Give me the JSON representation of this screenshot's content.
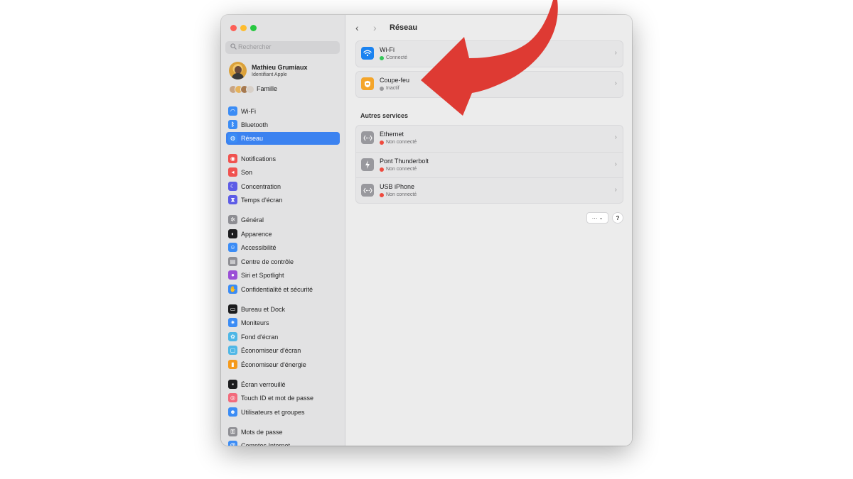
{
  "search": {
    "placeholder": "Rechercher"
  },
  "account": {
    "name": "Mathieu Grumiaux",
    "subtitle": "Identifiant Apple"
  },
  "family": {
    "label": "Famille"
  },
  "sidebar": {
    "items": [
      {
        "label": "Wi-Fi",
        "icon": "wifi-icon",
        "color": "#3b8cf5"
      },
      {
        "label": "Bluetooth",
        "icon": "bluetooth-icon",
        "color": "#3b8cf5"
      },
      {
        "label": "Réseau",
        "icon": "globe-icon",
        "color": "#3b8cf5",
        "selected": true
      },
      {
        "label": "Notifications",
        "icon": "bell-icon",
        "color": "#f0524f"
      },
      {
        "label": "Son",
        "icon": "speaker-icon",
        "color": "#f0524f"
      },
      {
        "label": "Concentration",
        "icon": "moon-icon",
        "color": "#5d5ce6"
      },
      {
        "label": "Temps d'écran",
        "icon": "hourglass-icon",
        "color": "#5d5ce6"
      },
      {
        "label": "Général",
        "icon": "gear-icon",
        "color": "#8e8e93"
      },
      {
        "label": "Apparence",
        "icon": "appearance-icon",
        "color": "#1c1c1e"
      },
      {
        "label": "Accessibilité",
        "icon": "accessibility-icon",
        "color": "#3b8cf5"
      },
      {
        "label": "Centre de contrôle",
        "icon": "control-center-icon",
        "color": "#8e8e93"
      },
      {
        "label": "Siri et Spotlight",
        "icon": "siri-icon",
        "color": "#9b4fd6"
      },
      {
        "label": "Confidentialité et sécurité",
        "icon": "hand-icon",
        "color": "#3b8cf5"
      },
      {
        "label": "Bureau et Dock",
        "icon": "dock-icon",
        "color": "#1c1c1e"
      },
      {
        "label": "Moniteurs",
        "icon": "sun-icon",
        "color": "#3b8cf5"
      },
      {
        "label": "Fond d'écran",
        "icon": "wallpaper-icon",
        "color": "#4fb7e6"
      },
      {
        "label": "Économiseur d'écran",
        "icon": "screensaver-icon",
        "color": "#4fb7e6"
      },
      {
        "label": "Économiseur d'énergie",
        "icon": "battery-icon",
        "color": "#f59a1c"
      },
      {
        "label": "Écran verrouillé",
        "icon": "lock-screen-icon",
        "color": "#1c1c1e"
      },
      {
        "label": "Touch ID et mot de passe",
        "icon": "fingerprint-icon",
        "color": "#f26b7c"
      },
      {
        "label": "Utilisateurs et groupes",
        "icon": "users-icon",
        "color": "#3b8cf5"
      },
      {
        "label": "Mots de passe",
        "icon": "key-icon",
        "color": "#8e8e93"
      },
      {
        "label": "Comptes Internet",
        "icon": "at-icon",
        "color": "#3b8cf5"
      }
    ]
  },
  "header": {
    "title": "Réseau"
  },
  "network": {
    "wifi": {
      "name": "Wi-Fi",
      "status": "Connecté",
      "status_color": "#34c759",
      "icon": "wifi-icon",
      "color": "#1a82f0"
    },
    "firewall": {
      "name": "Coupe-feu",
      "status": "Inactif",
      "status_color": "#9a9a9d",
      "icon": "firewall-icon",
      "color": "#f4a52a"
    }
  },
  "other_services": {
    "title": "Autres services",
    "items": [
      {
        "name": "Ethernet",
        "status": "Non connecté",
        "status_color": "#ef4a3e",
        "icon": "ethernet-icon",
        "color": "#98989d"
      },
      {
        "name": "Pont Thunderbolt",
        "status": "Non connecté",
        "status_color": "#ef4a3e",
        "icon": "thunderbolt-icon",
        "color": "#98989d"
      },
      {
        "name": "USB iPhone",
        "status": "Non connecté",
        "status_color": "#ef4a3e",
        "icon": "usb-icon",
        "color": "#98989d"
      }
    ]
  },
  "actions": {
    "more": "···",
    "help": "?"
  },
  "annotation": {
    "arrow_color": "#de3a33"
  }
}
